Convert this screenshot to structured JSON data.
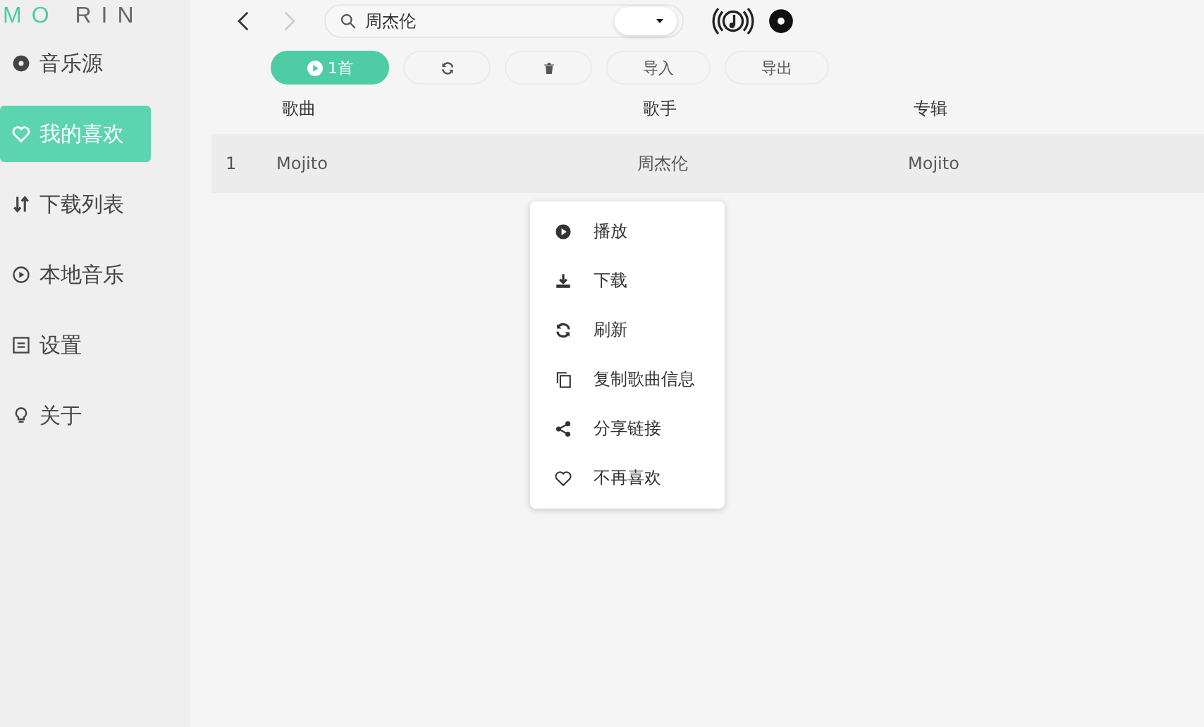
{
  "logo": {
    "accent": "MO",
    "rest": "RIN"
  },
  "sidebar": {
    "items": [
      {
        "kind": "source",
        "label": "音乐源",
        "selected": false
      },
      {
        "kind": "favorite",
        "label": "我的喜欢",
        "selected": true
      },
      {
        "kind": "download",
        "label": "下载列表",
        "selected": false
      },
      {
        "kind": "local",
        "label": "本地音乐",
        "selected": false
      },
      {
        "kind": "settings",
        "label": "设置",
        "selected": false
      },
      {
        "kind": "about",
        "label": "关于",
        "selected": false
      }
    ]
  },
  "toolbar": {
    "forward_disabled": true,
    "search": {
      "value": "周杰伦"
    }
  },
  "actions": [
    {
      "kind": "play",
      "label": "1首"
    },
    {
      "kind": "refresh"
    },
    {
      "kind": "delete"
    },
    {
      "kind": "text",
      "label": "导入"
    },
    {
      "kind": "text",
      "label": "导出"
    }
  ],
  "table": {
    "columns": [
      "歌曲",
      "歌手",
      "专辑"
    ],
    "rows": [
      {
        "index": "1",
        "song": "Mojito",
        "artist": "周杰伦",
        "album": "Mojito"
      }
    ]
  },
  "context_menu": {
    "items": [
      {
        "kind": "play",
        "label": "播放"
      },
      {
        "kind": "download",
        "label": "下载"
      },
      {
        "kind": "refresh",
        "label": "刷新"
      },
      {
        "kind": "copy",
        "label": "复制歌曲信息"
      },
      {
        "kind": "share",
        "label": "分享链接"
      },
      {
        "kind": "unlike",
        "label": "不再喜欢"
      }
    ]
  }
}
